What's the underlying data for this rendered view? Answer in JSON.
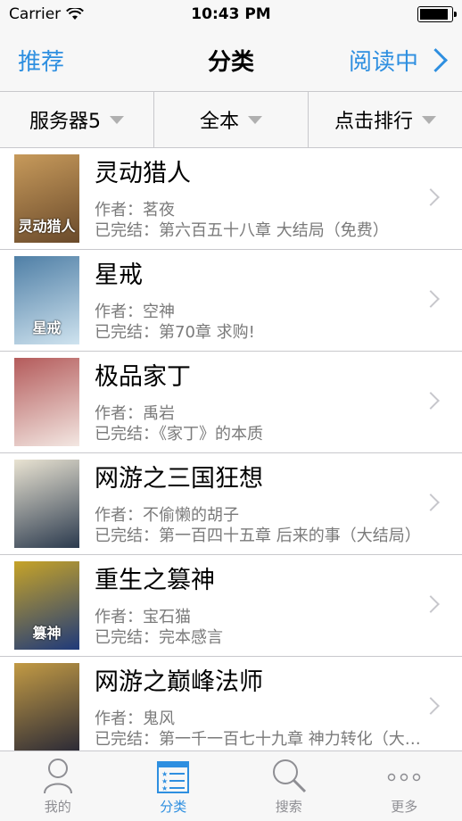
{
  "statusbar": {
    "carrier": "Carrier",
    "time": "10:43 PM"
  },
  "navbar": {
    "left": "推荐",
    "title": "分类",
    "right": "阅读中"
  },
  "filters": [
    "服务器5",
    "全本",
    "点击排行"
  ],
  "books": [
    {
      "title": "灵动猎人",
      "author": "作者：茗夜",
      "status": "已完结：第六百五十八章 大结局（免费）",
      "cover_label": "灵动猎人",
      "cover_colors": [
        "#6a4a2b",
        "#c79a5b"
      ]
    },
    {
      "title": "星戒",
      "author": "作者：空神",
      "status": "已完结：第70章 求购!",
      "cover_label": "星戒",
      "cover_colors": [
        "#cfe3ef",
        "#4f7fa6"
      ]
    },
    {
      "title": "极品家丁",
      "author": "作者：禹岩",
      "status": "已完结：《家丁》的本质",
      "cover_label": "",
      "cover_colors": [
        "#f3e7e2",
        "#b45b5b"
      ]
    },
    {
      "title": "网游之三国狂想",
      "author": "作者：不偷懒的胡子",
      "status": "已完结：第一百四十五章 后来的事（大结局）",
      "cover_label": "",
      "cover_colors": [
        "#2b3a4e",
        "#e9e3d2"
      ]
    },
    {
      "title": "重生之篡神",
      "author": "作者：宝石猫",
      "status": "已完结：完本感言",
      "cover_label": "篡神",
      "cover_colors": [
        "#1f3a7a",
        "#c6a328"
      ]
    },
    {
      "title": "网游之巅峰法师",
      "author": "作者：鬼风",
      "status": "已完结：第一千一百七十九章 神力转化（大结局）",
      "cover_label": "",
      "cover_colors": [
        "#2b2a36",
        "#c29a44"
      ]
    }
  ],
  "tabs": [
    {
      "label": "我的",
      "icon": "person-icon"
    },
    {
      "label": "分类",
      "icon": "list-icon"
    },
    {
      "label": "搜索",
      "icon": "search-icon"
    },
    {
      "label": "更多",
      "icon": "more-icon"
    }
  ],
  "colors": {
    "accent": "#2e8fe0",
    "secondary_text": "#7a7a7a"
  }
}
